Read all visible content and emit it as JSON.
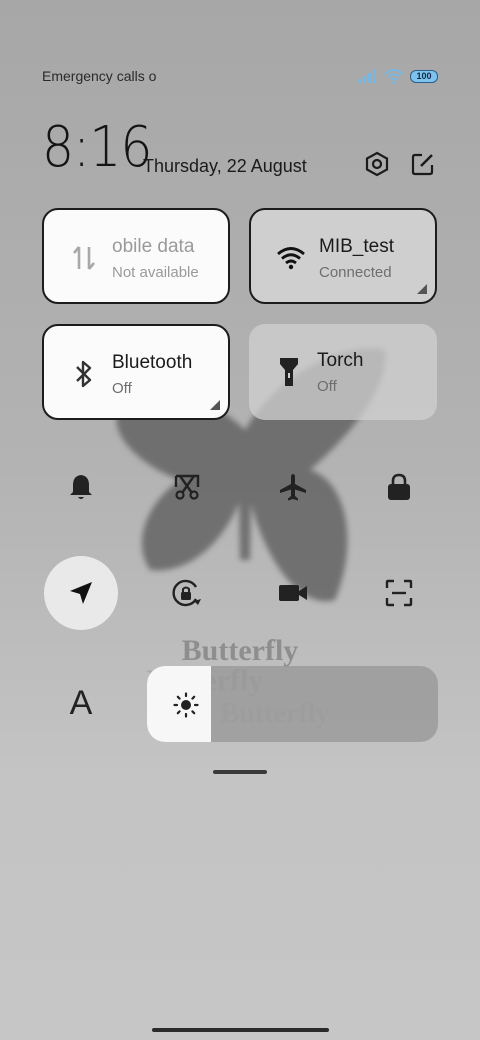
{
  "status_bar": {
    "carrier_text": "Emergency calls o",
    "battery_level": "100",
    "signal_icon": "signal-bars-icon",
    "wifi_icon": "wifi-icon"
  },
  "header": {
    "time": "8:16",
    "date": "Thursday, 22 August",
    "settings_icon": "settings-hexagon-icon",
    "edit_icon": "edit-icon"
  },
  "tiles": [
    {
      "title": "obile data",
      "subtitle": "Not available",
      "icon": "mobile-data-icon",
      "state": "unavailable"
    },
    {
      "title": "MIB_test",
      "subtitle": "Connected",
      "icon": "wifi-icon",
      "state": "on"
    },
    {
      "title": "Bluetooth",
      "subtitle": "Off",
      "icon": "bluetooth-icon",
      "state": "off"
    },
    {
      "title": "Torch",
      "subtitle": "Off",
      "icon": "torch-icon",
      "state": "off"
    }
  ],
  "toggles_row1": [
    "bell-icon",
    "screenshot-icon",
    "airplane-icon",
    "lock-icon"
  ],
  "toggles_row2": [
    "location-icon",
    "rotation-lock-icon",
    "video-camera-icon",
    "scan-icon"
  ],
  "brightness": {
    "level": 0.22,
    "icon": "sun-icon"
  },
  "font_toggle": {
    "label": "A"
  },
  "wallpaper": {
    "text": "Butterfly"
  },
  "colors": {
    "tile_active": "#fbfbfb",
    "tile_border": "#1c1c1c",
    "battery": "#7ec3ee"
  }
}
